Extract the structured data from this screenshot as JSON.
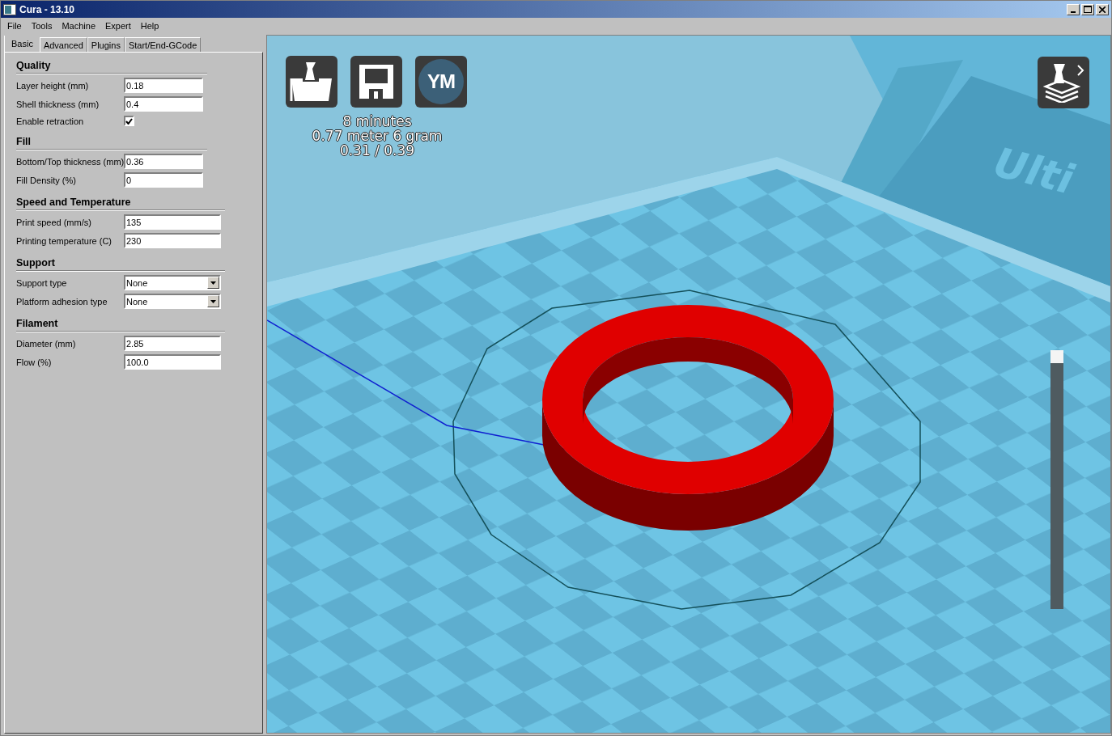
{
  "window": {
    "title": "Cura - 13.10"
  },
  "menu": [
    "File",
    "Tools",
    "Machine",
    "Expert",
    "Help"
  ],
  "tabs": [
    {
      "label": "Basic",
      "selected": true
    },
    {
      "label": "Advanced",
      "selected": false
    },
    {
      "label": "Plugins",
      "selected": false
    },
    {
      "label": "Start/End-GCode",
      "selected": false
    }
  ],
  "sections": [
    {
      "title": "Quality",
      "rows": [
        {
          "kind": "text",
          "label": "Layer height (mm)",
          "value": "0.18"
        },
        {
          "kind": "text",
          "label": "Shell thickness (mm)",
          "value": "0.4"
        },
        {
          "kind": "checkbox",
          "label": "Enable retraction",
          "checked": true
        }
      ]
    },
    {
      "title": "Fill",
      "rows": [
        {
          "kind": "text",
          "label": "Bottom/Top thickness (mm)",
          "value": "0.36"
        },
        {
          "kind": "text",
          "label": "Fill Density (%)",
          "value": "0"
        }
      ]
    },
    {
      "title": "Speed and Temperature",
      "rows": [
        {
          "kind": "text",
          "label": "Print speed (mm/s)",
          "value": "135"
        },
        {
          "kind": "text",
          "label": "Printing temperature (C)",
          "value": "230"
        }
      ]
    },
    {
      "title": "Support",
      "rows": [
        {
          "kind": "select",
          "label": "Support type",
          "value": "None"
        },
        {
          "kind": "select",
          "label": "Platform adhesion type",
          "value": "None"
        }
      ]
    },
    {
      "title": "Filament",
      "rows": [
        {
          "kind": "text",
          "label": "Diameter (mm)",
          "value": "2.85"
        },
        {
          "kind": "text",
          "label": "Flow (%)",
          "value": "100.0"
        }
      ]
    }
  ],
  "viewport": {
    "buttons": [
      {
        "kind": "load"
      },
      {
        "kind": "save"
      },
      {
        "kind": "youmagine",
        "label": "YM"
      }
    ],
    "stats": [
      "8 minutes",
      "0.77 meter 6 gram",
      "0.31 / 0.39"
    ],
    "backplate_text": "Ulti",
    "layer_slider": {
      "level": 1
    }
  }
}
